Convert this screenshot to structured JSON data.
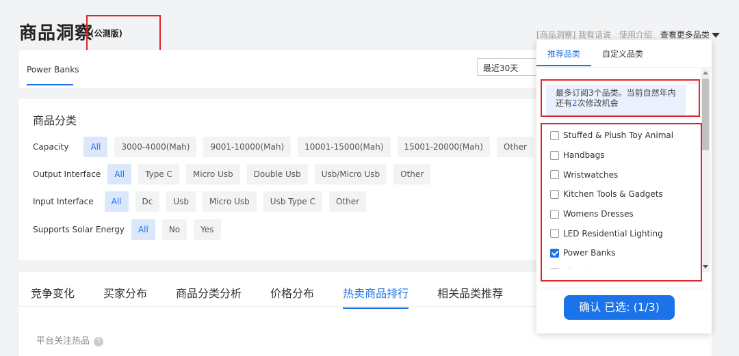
{
  "header": {
    "title": "商品洞察",
    "badge": "(公测版)"
  },
  "top_links": {
    "link1": "[商品洞察] 我有话说",
    "link2": "使用介绍",
    "more": "查看更多品类"
  },
  "category_tab": {
    "label": "Power Banks"
  },
  "date_select": {
    "value": "最近30天"
  },
  "filters": {
    "heading": "商品分类",
    "rows": [
      {
        "label": "Capacity",
        "options": [
          "All",
          "3000-4000(Mah)",
          "9001-10000(Mah)",
          "10001-15000(Mah)",
          "15001-20000(Mah)",
          "Other"
        ]
      },
      {
        "label": "Output Interface",
        "options": [
          "All",
          "Type C",
          "Micro Usb",
          "Double Usb",
          "Usb/Micro Usb",
          "Other"
        ]
      },
      {
        "label": "Input Interface",
        "options": [
          "All",
          "Dc",
          "Usb",
          "Micro Usb",
          "Usb Type C",
          "Other"
        ]
      },
      {
        "label": "Supports Solar Energy",
        "options": [
          "All",
          "No",
          "Yes"
        ]
      }
    ]
  },
  "analysis_tabs": [
    "竞争变化",
    "买家分布",
    "商品分类分析",
    "价格分布",
    "热卖商品排行",
    "相关品类推荐"
  ],
  "subtitle": "平台关注热品",
  "dropdown": {
    "tabs": [
      "推荐品类",
      "自定义品类"
    ],
    "notice_line1": "最多订阅3个品类。当前自然年内",
    "notice_pre": "还有",
    "notice_num": "2",
    "notice_post": "次修改机会",
    "items": [
      {
        "label": "Stuffed & Plush Toy Animal",
        "checked": false
      },
      {
        "label": "Handbags",
        "checked": false
      },
      {
        "label": "Wristwatches",
        "checked": false
      },
      {
        "label": "Kitchen Tools & Gadgets",
        "checked": false
      },
      {
        "label": "Womens Dresses",
        "checked": false
      },
      {
        "label": "LED Residential Lighting",
        "checked": false
      },
      {
        "label": "Power Banks",
        "checked": true
      },
      {
        "label": "Bicycle",
        "checked": false
      }
    ],
    "confirm": "确认 已选: (1/3)"
  },
  "colors": {
    "accent": "#1a73e8",
    "highlight_box": "#e0252b"
  }
}
